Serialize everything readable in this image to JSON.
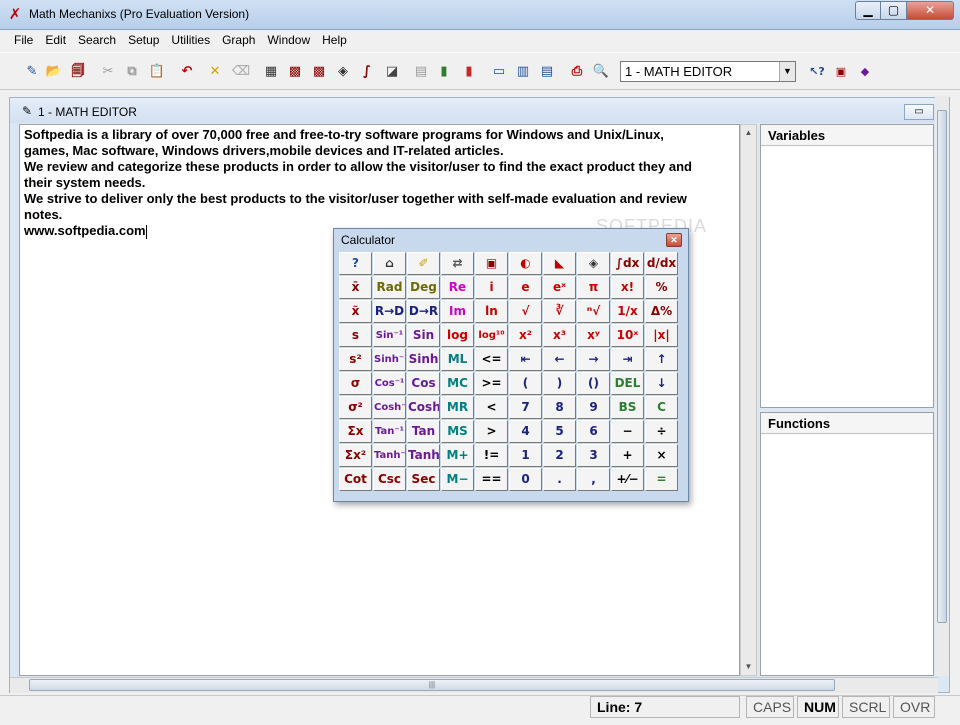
{
  "window": {
    "title": "Math Mechanixs (Pro Evaluation Version)",
    "min_glyph": "▁",
    "max_glyph": "▢",
    "close_glyph": "✕"
  },
  "menu": [
    "File",
    "Edit",
    "Search",
    "Setup",
    "Utilities",
    "Graph",
    "Window",
    "Help"
  ],
  "toolbar": {
    "buttons": [
      {
        "name": "pencil-icon",
        "glyph": "✎",
        "color": "#1f4e9a"
      },
      {
        "name": "open-icon",
        "glyph": "📂",
        "color": "#a0522d"
      },
      {
        "name": "copy-doc-icon",
        "glyph": "🗐",
        "color": "#8b0000"
      },
      {
        "name": "cut-icon",
        "glyph": "✂",
        "color": "#9a9a9a"
      },
      {
        "name": "duplicate-icon",
        "glyph": "⧉",
        "color": "#9a9a9a"
      },
      {
        "name": "paste-icon",
        "glyph": "📋",
        "color": "#1f4e9a"
      },
      {
        "name": "undo-icon",
        "glyph": "↶",
        "color": "#c00000"
      },
      {
        "name": "eraser-icon",
        "glyph": "✕",
        "color": "#d4a000"
      },
      {
        "name": "clear-icon",
        "glyph": "⌫",
        "color": "#b0b0b0"
      },
      {
        "name": "calculator-icon",
        "glyph": "▦",
        "color": "#333333"
      },
      {
        "name": "matrix-icon",
        "glyph": "▩",
        "color": "#8b0000"
      },
      {
        "name": "matrix-solve-icon",
        "glyph": "▩",
        "color": "#8b0000"
      },
      {
        "name": "diamond-icon",
        "glyph": "◈",
        "color": "#333333"
      },
      {
        "name": "derivative-icon",
        "glyph": "∫",
        "color": "#8b0000"
      },
      {
        "name": "graph-icon",
        "glyph": "◪",
        "color": "#444444"
      },
      {
        "name": "notes-icon",
        "glyph": "▤",
        "color": "#9a9a9a"
      },
      {
        "name": "bar-chart-icon",
        "glyph": "▮",
        "color": "#2e7d32"
      },
      {
        "name": "bar-chart-3d-icon",
        "glyph": "▮",
        "color": "#c62828"
      },
      {
        "name": "window-icon",
        "glyph": "▭",
        "color": "#1f4e9a"
      },
      {
        "name": "tile-icon",
        "glyph": "▥",
        "color": "#1f4e9a"
      },
      {
        "name": "cascade-icon",
        "glyph": "▤",
        "color": "#1f4e9a"
      },
      {
        "name": "print-icon",
        "glyph": "⎙",
        "color": "#c00000"
      },
      {
        "name": "print-preview-icon",
        "glyph": "🔍",
        "color": "#333333"
      }
    ],
    "combo_value": "1 - MATH EDITOR",
    "combo_arrow": "▼",
    "right_buttons": [
      {
        "name": "help-cursor-icon",
        "glyph": "↖?",
        "color": "#1f4e9a"
      },
      {
        "name": "book-icon",
        "glyph": "▣",
        "color": "#8b0000"
      },
      {
        "name": "books-icon",
        "glyph": "◆",
        "color": "#6a1b9a"
      }
    ]
  },
  "mdi": {
    "title": "1 - MATH EDITOR",
    "min_glyph": "▭"
  },
  "editor": {
    "lines": [
      "Softpedia is a library of over 70,000 free and free-to-try software programs for Windows and Unix/Linux,",
      "games, Mac software, Windows drivers,mobile devices and IT-related articles.",
      "We review and categorize these products in order to allow the visitor/user to find the exact product they and",
      "their system needs.",
      "We strive to deliver only the best products to the visitor/user together with self-made evaluation and review",
      "notes.",
      "www.softpedia.com"
    ]
  },
  "panels": {
    "variables": "Variables",
    "functions": "Functions"
  },
  "watermark": "SOFTPEDIA",
  "calculator": {
    "title": "Calculator",
    "close_glyph": "✕",
    "keys": [
      [
        "?",
        "⌂",
        "✐",
        "⇄",
        "▣",
        "◐",
        "◣",
        "◈",
        "∫dx",
        "d/dx"
      ],
      [
        "x̄",
        "Rad",
        "Deg",
        "Re",
        "i",
        "e",
        "eˣ",
        "π",
        "x!",
        "%"
      ],
      [
        "x̃",
        "R→D",
        "D→R",
        "Im",
        "ln",
        "√",
        "∛",
        "ⁿ√",
        "1/x",
        "Δ%"
      ],
      [
        "s",
        "Sin⁻¹",
        "Sin",
        "log",
        "log¹⁰",
        "x²",
        "x³",
        "xʸ",
        "10ˣ",
        "|x|"
      ],
      [
        "s²",
        "Sinh⁻¹",
        "Sinh",
        "ML",
        "<=",
        "⇤",
        "←",
        "→",
        "⇥",
        "↑"
      ],
      [
        "σ",
        "Cos⁻¹",
        "Cos",
        "MC",
        ">=",
        "(",
        ")",
        "()",
        "DEL",
        "↓"
      ],
      [
        "σ²",
        "Cosh⁻¹",
        "Cosh",
        "MR",
        "<",
        "7",
        "8",
        "9",
        "BS",
        "C"
      ],
      [
        "Σx",
        "Tan⁻¹",
        "Tan",
        "MS",
        ">",
        "4",
        "5",
        "6",
        "−",
        "÷"
      ],
      [
        "Σx²",
        "Tanh⁻¹",
        "Tanh",
        "M+",
        "!=",
        "1",
        "2",
        "3",
        "+",
        "×"
      ],
      [
        "Cot",
        "Csc",
        "Sec",
        "M−",
        "==",
        "0",
        ".",
        ",",
        "+⁄−",
        "="
      ]
    ],
    "key_colors": [
      [
        "#1f4e9a",
        "#333333",
        "#c9a000",
        "#555555",
        "#8b0000",
        "#c00000",
        "#c00000",
        "#333333",
        "#8b0000",
        "#8b0000"
      ],
      [
        "#8b0000",
        "#6b6b00",
        "#6b6b00",
        "#cc00cc",
        "#cc0000",
        "#cc0000",
        "#cc0000",
        "#cc0000",
        "#cc0000",
        "#8b0000"
      ],
      [
        "#8b0000",
        "#1a237e",
        "#1a237e",
        "#cc00cc",
        "#cc0000",
        "#cc0000",
        "#cc0000",
        "#cc0000",
        "#cc0000",
        "#8b0000"
      ],
      [
        "#8b0000",
        "#6a1b9a",
        "#6a1b9a",
        "#cc0000",
        "#cc0000",
        "#cc0000",
        "#cc0000",
        "#cc0000",
        "#cc0000",
        "#cc0000"
      ],
      [
        "#8b0000",
        "#6a1b9a",
        "#6a1b9a",
        "#008080",
        "#000000",
        "#1a237e",
        "#1a237e",
        "#1a237e",
        "#1a237e",
        "#1a237e"
      ],
      [
        "#8b0000",
        "#6a1b9a",
        "#6a1b9a",
        "#008080",
        "#000000",
        "#1a237e",
        "#1a237e",
        "#1a237e",
        "#2e7d32",
        "#1a237e"
      ],
      [
        "#8b0000",
        "#6a1b9a",
        "#6a1b9a",
        "#008080",
        "#000000",
        "#1a237e",
        "#1a237e",
        "#1a237e",
        "#2e7d32",
        "#2e7d32"
      ],
      [
        "#8b0000",
        "#6a1b9a",
        "#6a1b9a",
        "#008080",
        "#000000",
        "#1a237e",
        "#1a237e",
        "#1a237e",
        "#000000",
        "#000000"
      ],
      [
        "#8b0000",
        "#6a1b9a",
        "#6a1b9a",
        "#008080",
        "#000000",
        "#1a237e",
        "#1a237e",
        "#1a237e",
        "#000000",
        "#000000"
      ],
      [
        "#8b0000",
        "#8b0000",
        "#8b0000",
        "#008080",
        "#000000",
        "#1a237e",
        "#1a237e",
        "#1a237e",
        "#000000",
        "#2e7d32"
      ]
    ]
  },
  "status": {
    "line": "Line: 7",
    "caps": "CAPS",
    "num": "NUM",
    "scrl": "SCRL",
    "ovr": "OVR"
  },
  "scroll": {
    "up": "▲",
    "down": "▼",
    "left": "◀",
    "right": "▶",
    "grip": "|||"
  }
}
